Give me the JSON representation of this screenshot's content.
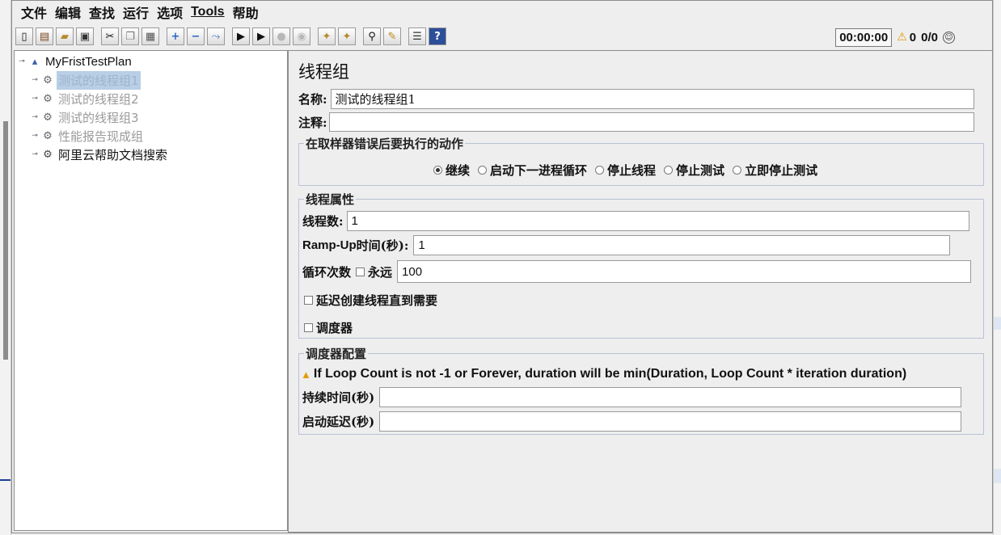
{
  "menu": [
    "文件",
    "编辑",
    "查找",
    "运行",
    "选项",
    "Tools",
    "帮助"
  ],
  "status": {
    "elapsed": "00:00:00",
    "warning_count": "0",
    "threads": "0/0"
  },
  "tree": {
    "root": "MyFristTestPlan",
    "items": [
      {
        "label": "测试的线程组1",
        "state": "selected-disabled"
      },
      {
        "label": "测试的线程组2",
        "state": "disabled"
      },
      {
        "label": "测试的线程组3",
        "state": "disabled"
      },
      {
        "label": "性能报告现成组",
        "state": "disabled"
      },
      {
        "label": "阿里云帮助文档搜索",
        "state": "enabled"
      }
    ]
  },
  "panel": {
    "title": "线程组",
    "name_label": "名称:",
    "name_value": "测试的线程组1",
    "comment_label": "注释:",
    "comment_value": "",
    "on_error": {
      "title": "在取样器错误后要执行的动作",
      "options": [
        "继续",
        "启动下一进程循环",
        "停止线程",
        "停止测试",
        "立即停止测试"
      ],
      "selected": "继续"
    },
    "thread_props": {
      "title": "线程属性",
      "threads_label": "线程数:",
      "threads_value": "1",
      "rampup_label_en": "Ramp-Up",
      "rampup_label_cn": "时间(秒):",
      "rampup_value": "1",
      "loop_label": "循环次数",
      "forever_label": "永远",
      "forever_checked": false,
      "loop_value": "100",
      "delay_label": "延迟创建线程直到需要",
      "delay_checked": false,
      "scheduler_label": "调度器",
      "scheduler_checked": false
    },
    "scheduler": {
      "title": "调度器配置",
      "warning": "If Loop Count is not -1 or Forever, duration will be min(Duration, Loop Count * iteration duration)",
      "duration_label": "持续时间(秒)",
      "duration_value": "",
      "startup_delay_label": "启动延迟(秒)",
      "startup_delay_value": ""
    }
  }
}
